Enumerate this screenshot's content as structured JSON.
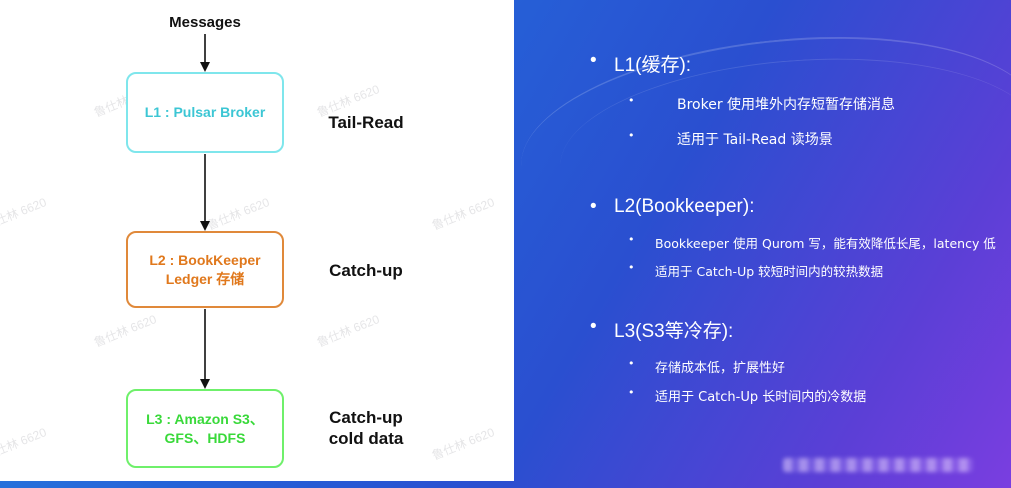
{
  "diagram": {
    "input_label": "Messages",
    "boxes": [
      {
        "id": "l1",
        "lines": [
          "L1 : Pulsar Broker"
        ],
        "side_label": [
          "Tail-Read"
        ],
        "color": "#3cc6d4"
      },
      {
        "id": "l2",
        "lines": [
          "L2 : BookKeeper",
          "Ledger 存储"
        ],
        "side_label": [
          "Catch-up"
        ],
        "color": "#e0781c"
      },
      {
        "id": "l3",
        "lines": [
          "L3 : Amazon S3、",
          "GFS、HDFS"
        ],
        "side_label": [
          "Catch-up",
          "cold data"
        ],
        "color": "#39d93a"
      }
    ],
    "watermark": "鲁仕林 6620"
  },
  "bullets": [
    {
      "title": "L1(缓存):",
      "items": [
        "Broker 使用堆外内存短暂存储消息",
        "适用于 Tail-Read 读场景"
      ]
    },
    {
      "title": "L2(Bookkeeper):",
      "items": [
        "Bookkeeper 使用 Qurom 写，能有效降低长尾，latency 低",
        "适用于 Catch-Up 较短时间内的较热数据"
      ]
    },
    {
      "title": "L3(S3等冷存):",
      "items": [
        "存储成本低，扩展性好",
        "适用于 Catch-Up 长时间内的冷数据"
      ]
    }
  ],
  "bullet_symbol": "•"
}
